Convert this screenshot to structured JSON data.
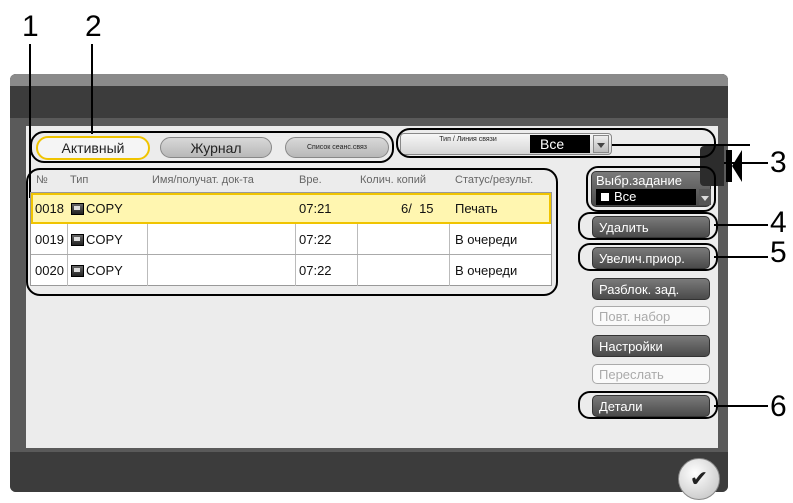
{
  "callouts": [
    "1",
    "2",
    "3",
    "4",
    "5",
    "6"
  ],
  "tabs": {
    "active": "Активный",
    "journal": "Журнал",
    "session_list": "Список сеанс.связ"
  },
  "filter": {
    "label": "Тип / Линия связи",
    "value": "Все"
  },
  "table": {
    "columns": [
      "№",
      "Тип",
      "Имя/получат. док-та",
      "Вре.",
      "Колич. копий",
      "Статус/результ."
    ],
    "rows": [
      {
        "no": "0018",
        "type": "COPY",
        "name": "",
        "time": "07:21",
        "copies": "6/  15",
        "status": "Печать"
      },
      {
        "no": "0019",
        "type": "COPY",
        "name": "",
        "time": "07:22",
        "copies": "",
        "status": "В очереди"
      },
      {
        "no": "0020",
        "type": "COPY",
        "name": "",
        "time": "07:22",
        "copies": "",
        "status": "В очереди"
      }
    ]
  },
  "job_select": {
    "title": "Выбр.задание",
    "value": "Все"
  },
  "buttons": {
    "delete": "Удалить",
    "raise_priority": "Увелич.приор.",
    "release": "Разблок. зад.",
    "redial": "Повт. набор",
    "settings": "Настройки",
    "forward": "Переслать",
    "details": "Детали"
  },
  "ok_glyph": "✔"
}
